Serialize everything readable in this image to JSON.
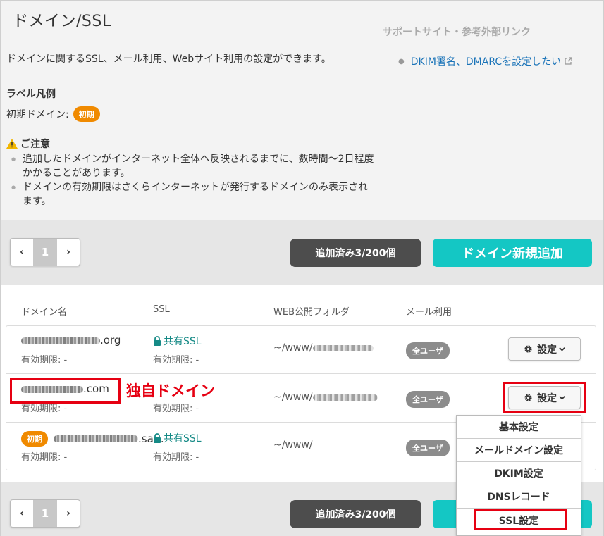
{
  "page_title": "ドメイン/SSL",
  "support": {
    "heading": "サポートサイト・参考外部リンク",
    "link_label": "DKIM署名、DMARCを設定したい"
  },
  "description": "ドメインに関するSSL、メール利用、Webサイト利用の設定ができます。",
  "legend": {
    "heading": "ラベル凡例",
    "initial_label": "初期ドメイン:",
    "initial_badge": "初期"
  },
  "notice": {
    "heading": "ご注意",
    "items": [
      "追加したドメインがインターネット全体へ反映されるまでに、数時間〜2日程度かかることがあります。",
      "ドメインの有効期限はさくらインターネットが発行するドメインのみ表示されます。"
    ]
  },
  "pager": {
    "prev": "‹",
    "page": "1",
    "next": "›"
  },
  "count_label": "追加済み3/200個",
  "add_button": "ドメイン新規追加",
  "table": {
    "headers": [
      "ドメイン名",
      "SSL",
      "WEB公開フォルダ",
      "メール利用"
    ],
    "rows": [
      {
        "domain_suffix": ".org",
        "expiry": "有効期限: -",
        "ssl": "共有SSL",
        "ssl_expiry": "有効期限: -",
        "folder": "~/www/",
        "mail": "全ユーザ",
        "action": "設定"
      },
      {
        "domain_suffix": ".com",
        "expiry": "有効期限: -",
        "ssl": "",
        "ssl_expiry": "有効期限: -",
        "folder": "~/www/",
        "mail": "全ユーザ",
        "action": "設定"
      },
      {
        "badge": "初期",
        "domain_suffix": ".sa…",
        "expiry": "有効期限: -",
        "ssl": "共有SSL",
        "ssl_expiry": "有効期限: -",
        "folder": "~/www/",
        "mail": "全ユーザ",
        "action": "設定"
      }
    ]
  },
  "annotation_label": "独自ドメイン",
  "menu": [
    "基本設定",
    "メールドメイン設定",
    "DKIM設定",
    "DNSレコード",
    "SSL設定"
  ],
  "colors": {
    "accent": "#14c7c4",
    "ssl_green": "#168a86",
    "badge_orange": "#f08a00",
    "highlight_red": "#e60012",
    "link_blue": "#1a73b8"
  }
}
